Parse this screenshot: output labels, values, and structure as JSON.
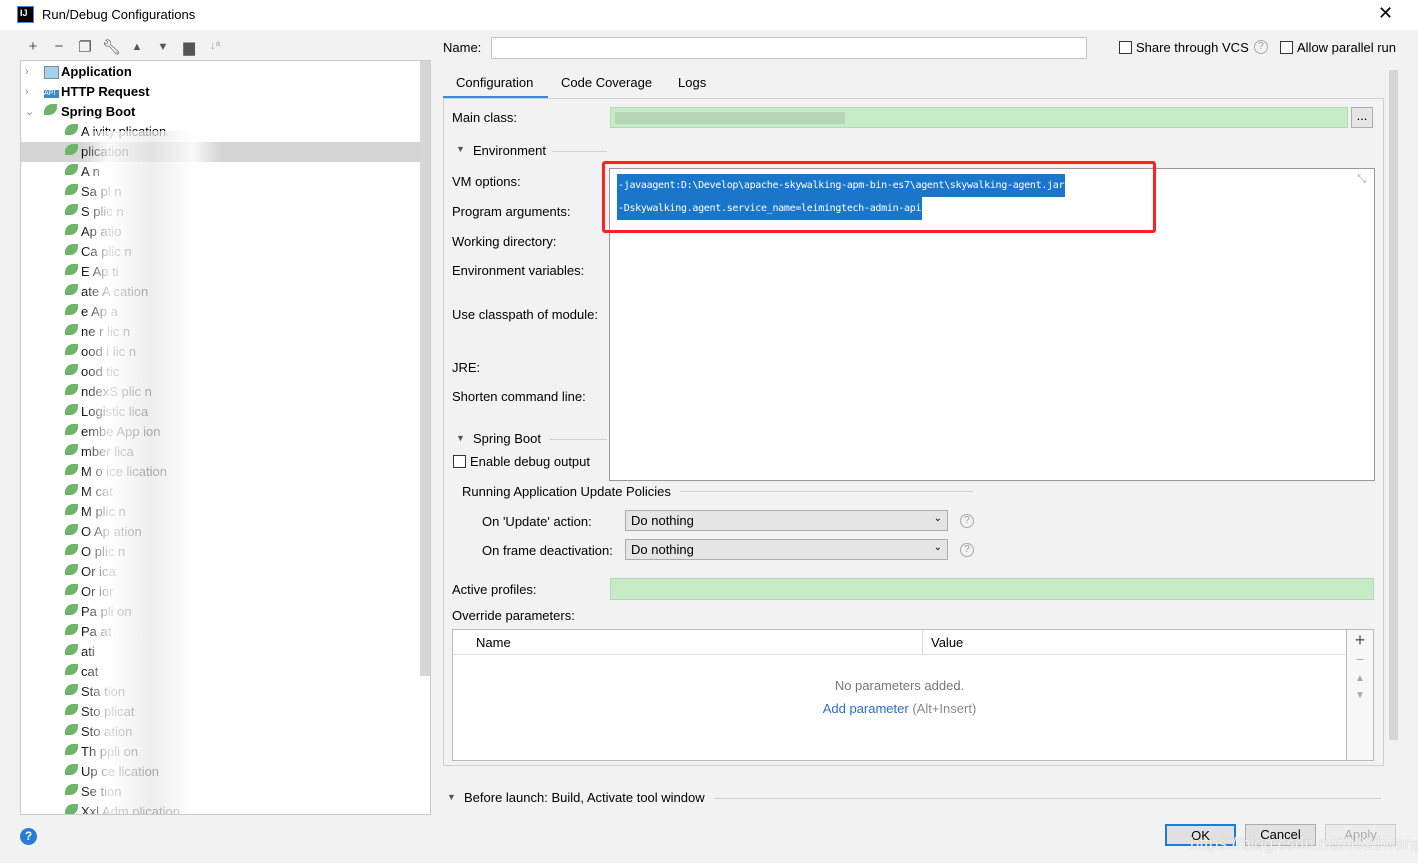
{
  "window": {
    "title": "Run/Debug Configurations",
    "app_icon": "IJ"
  },
  "toolbar": [
    "add-icon",
    "remove-icon",
    "copy-icon",
    "wrench-icon",
    "move-up-icon",
    "move-down-icon",
    "new-folder-icon",
    "sort-icon"
  ],
  "tree": {
    "groups": [
      {
        "label": "Application",
        "expanded": false
      },
      {
        "label": "HTTP Request",
        "expanded": false
      },
      {
        "label": "Spring Boot",
        "expanded": true
      }
    ],
    "items": [
      "A ivity  plication",
      "plication",
      "A     n",
      "Sa   pl    n",
      "S   plic   n",
      "Ap   atio",
      "Ca   plic   n",
      "E   Ap    ti",
      "   ate   A   cation",
      "e   Ap   a",
      "ne   r   lic   n",
      "ood   i   lic   n",
      "ood      tic",
      "ndexS   plic   n",
      "Logistic   lica",
      "embe   App   ion",
      "mber   lica",
      "M   o   ice   lication",
      "M      cat",
      "M      plic   n",
      "O      Ap   ation",
      "O      plic   n",
      "Or      ica",
      "Or      ior",
      "Pa      pli   on",
      "Pa      at",
      "      ati",
      "      cat",
      "Sta      tion",
      "Sto      plicat",
      "Sto      ation",
      "Th      ppli   on",
      "Up      ce   lication",
      "Se      tion",
      "Xxl   Adm   plication"
    ],
    "selected_index": 1
  },
  "form": {
    "name_label": "Name:",
    "name_value": "",
    "share_vcs": "Share through VCS",
    "allow_parallel": "Allow parallel run",
    "tabs": [
      "Configuration",
      "Code Coverage",
      "Logs"
    ],
    "active_tab": 0,
    "main_class_label": "Main class:",
    "browse": "...",
    "environment": "Environment",
    "vm_options_label": "VM options:",
    "vm_options": [
      "-javaagent:D:\\Develop\\apache-skywalking-apm-bin-es7\\agent\\skywalking-agent.jar",
      "-Dskywalking.agent.service_name=leimingtech-admin-api"
    ],
    "program_args": "Program arguments:",
    "working_dir": "Working directory:",
    "env_vars": "Environment variables:",
    "classpath": "Use classpath of module:",
    "jre": "JRE:",
    "shorten": "Shorten command line:",
    "spring_boot": "Spring Boot",
    "debug_output": "Enable debug output",
    "policies": "Running Application Update Policies",
    "on_update_label": "On 'Update' action:",
    "on_update_value": "Do nothing",
    "on_frame_label": "On frame deactivation:",
    "on_frame_value": "Do nothing",
    "active_profiles": "Active profiles:",
    "override": "Override parameters:",
    "table": {
      "columns": [
        "Name",
        "Value"
      ],
      "empty": "No parameters added.",
      "add_link": "Add parameter",
      "add_hint": "(Alt+Insert)"
    },
    "before_launch": "Before launch: Build, Activate tool window"
  },
  "buttons": {
    "ok": "OK",
    "cancel": "Cancel",
    "apply": "Apply"
  },
  "watermark": "https://blog.csdn.net/li521wang",
  "colors": {
    "selection": "#1a76c9",
    "highlight_box": "#ff2020",
    "field_green": "#c7ebc7",
    "link": "#2a6fc9"
  }
}
